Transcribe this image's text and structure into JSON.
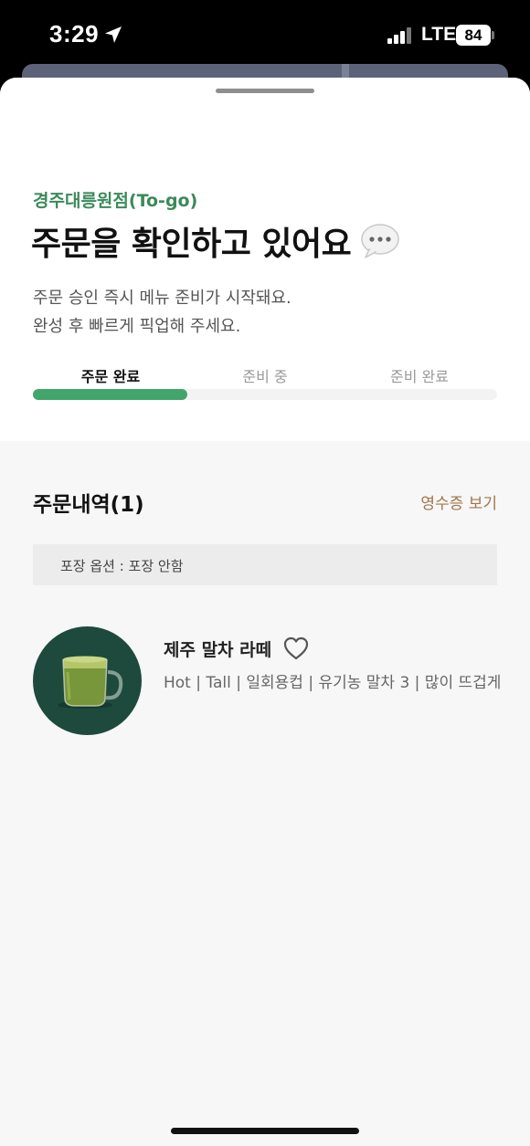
{
  "status_bar": {
    "time": "3:29",
    "network": "LTE",
    "battery": "84"
  },
  "order_status": {
    "store_name": "경주대릉원점(To-go)",
    "title": "주문을 확인하고 있어요",
    "description_line1": "주문 승인 즉시 메뉴 준비가 시작돼요.",
    "description_line2": "완성 후 빠르게 픽업해 주세요.",
    "steps": [
      {
        "label": "주문 완료",
        "active": true
      },
      {
        "label": "준비 중",
        "active": false
      },
      {
        "label": "준비 완료",
        "active": false
      }
    ],
    "progress": 0.333
  },
  "order_details": {
    "title": "주문내역(1)",
    "receipt_link": "영수증 보기",
    "packaging_option": "포장 옵션 : 포장 안함",
    "items": [
      {
        "name": "제주 말차 라떼",
        "options": "Hot | Tall | 일회용컵 | 유기농 말차 3 | 많이 뜨겁게"
      }
    ]
  },
  "colors": {
    "accent_green": "#42a56b",
    "store_green": "#3b8a5a",
    "receipt_brown": "#a0764a"
  },
  "icons": {
    "location": "location-arrow-icon",
    "chat": "speech-bubble-icon",
    "favorite": "heart-outline-icon"
  }
}
